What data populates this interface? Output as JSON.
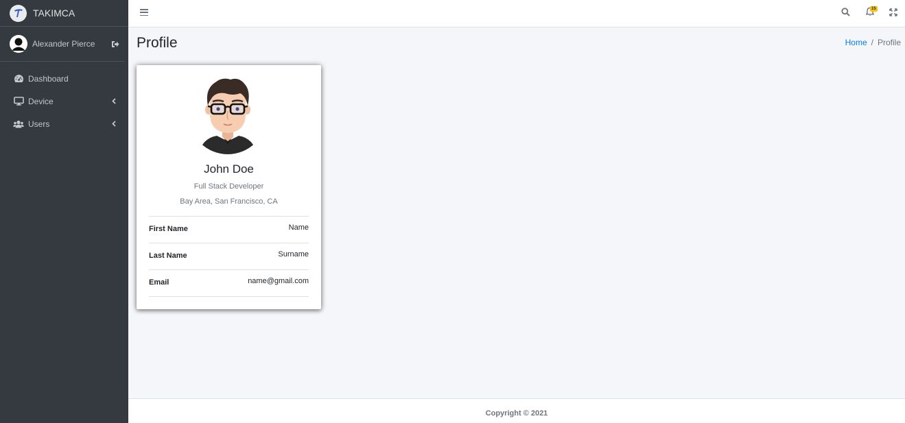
{
  "brand": {
    "name": "TAKIMCA"
  },
  "user": {
    "name": "Alexander Pierce"
  },
  "nav": [
    {
      "label": "Dashboard",
      "icon": "tachometer-icon"
    },
    {
      "label": "Device",
      "icon": "desktop-icon"
    },
    {
      "label": "Users",
      "icon": "users-icon"
    }
  ],
  "header": {
    "notification_count": "15"
  },
  "page": {
    "title": "Profile"
  },
  "breadcrumb": {
    "home": "Home",
    "current": "Profile"
  },
  "profile": {
    "name": "John Doe",
    "role": "Full Stack Developer",
    "location": "Bay Area, San Francisco, CA",
    "fields": [
      {
        "label": "First Name",
        "value": "Name"
      },
      {
        "label": "Last Name",
        "value": "Surname"
      },
      {
        "label": "Email",
        "value": "name@gmail.com"
      }
    ]
  },
  "footer": {
    "text": "Copyright © 2021"
  },
  "colors": {
    "sidebar": "#343a40",
    "accent": "#007bff",
    "badge": "#ffc107",
    "background": "#f4f6f9"
  }
}
